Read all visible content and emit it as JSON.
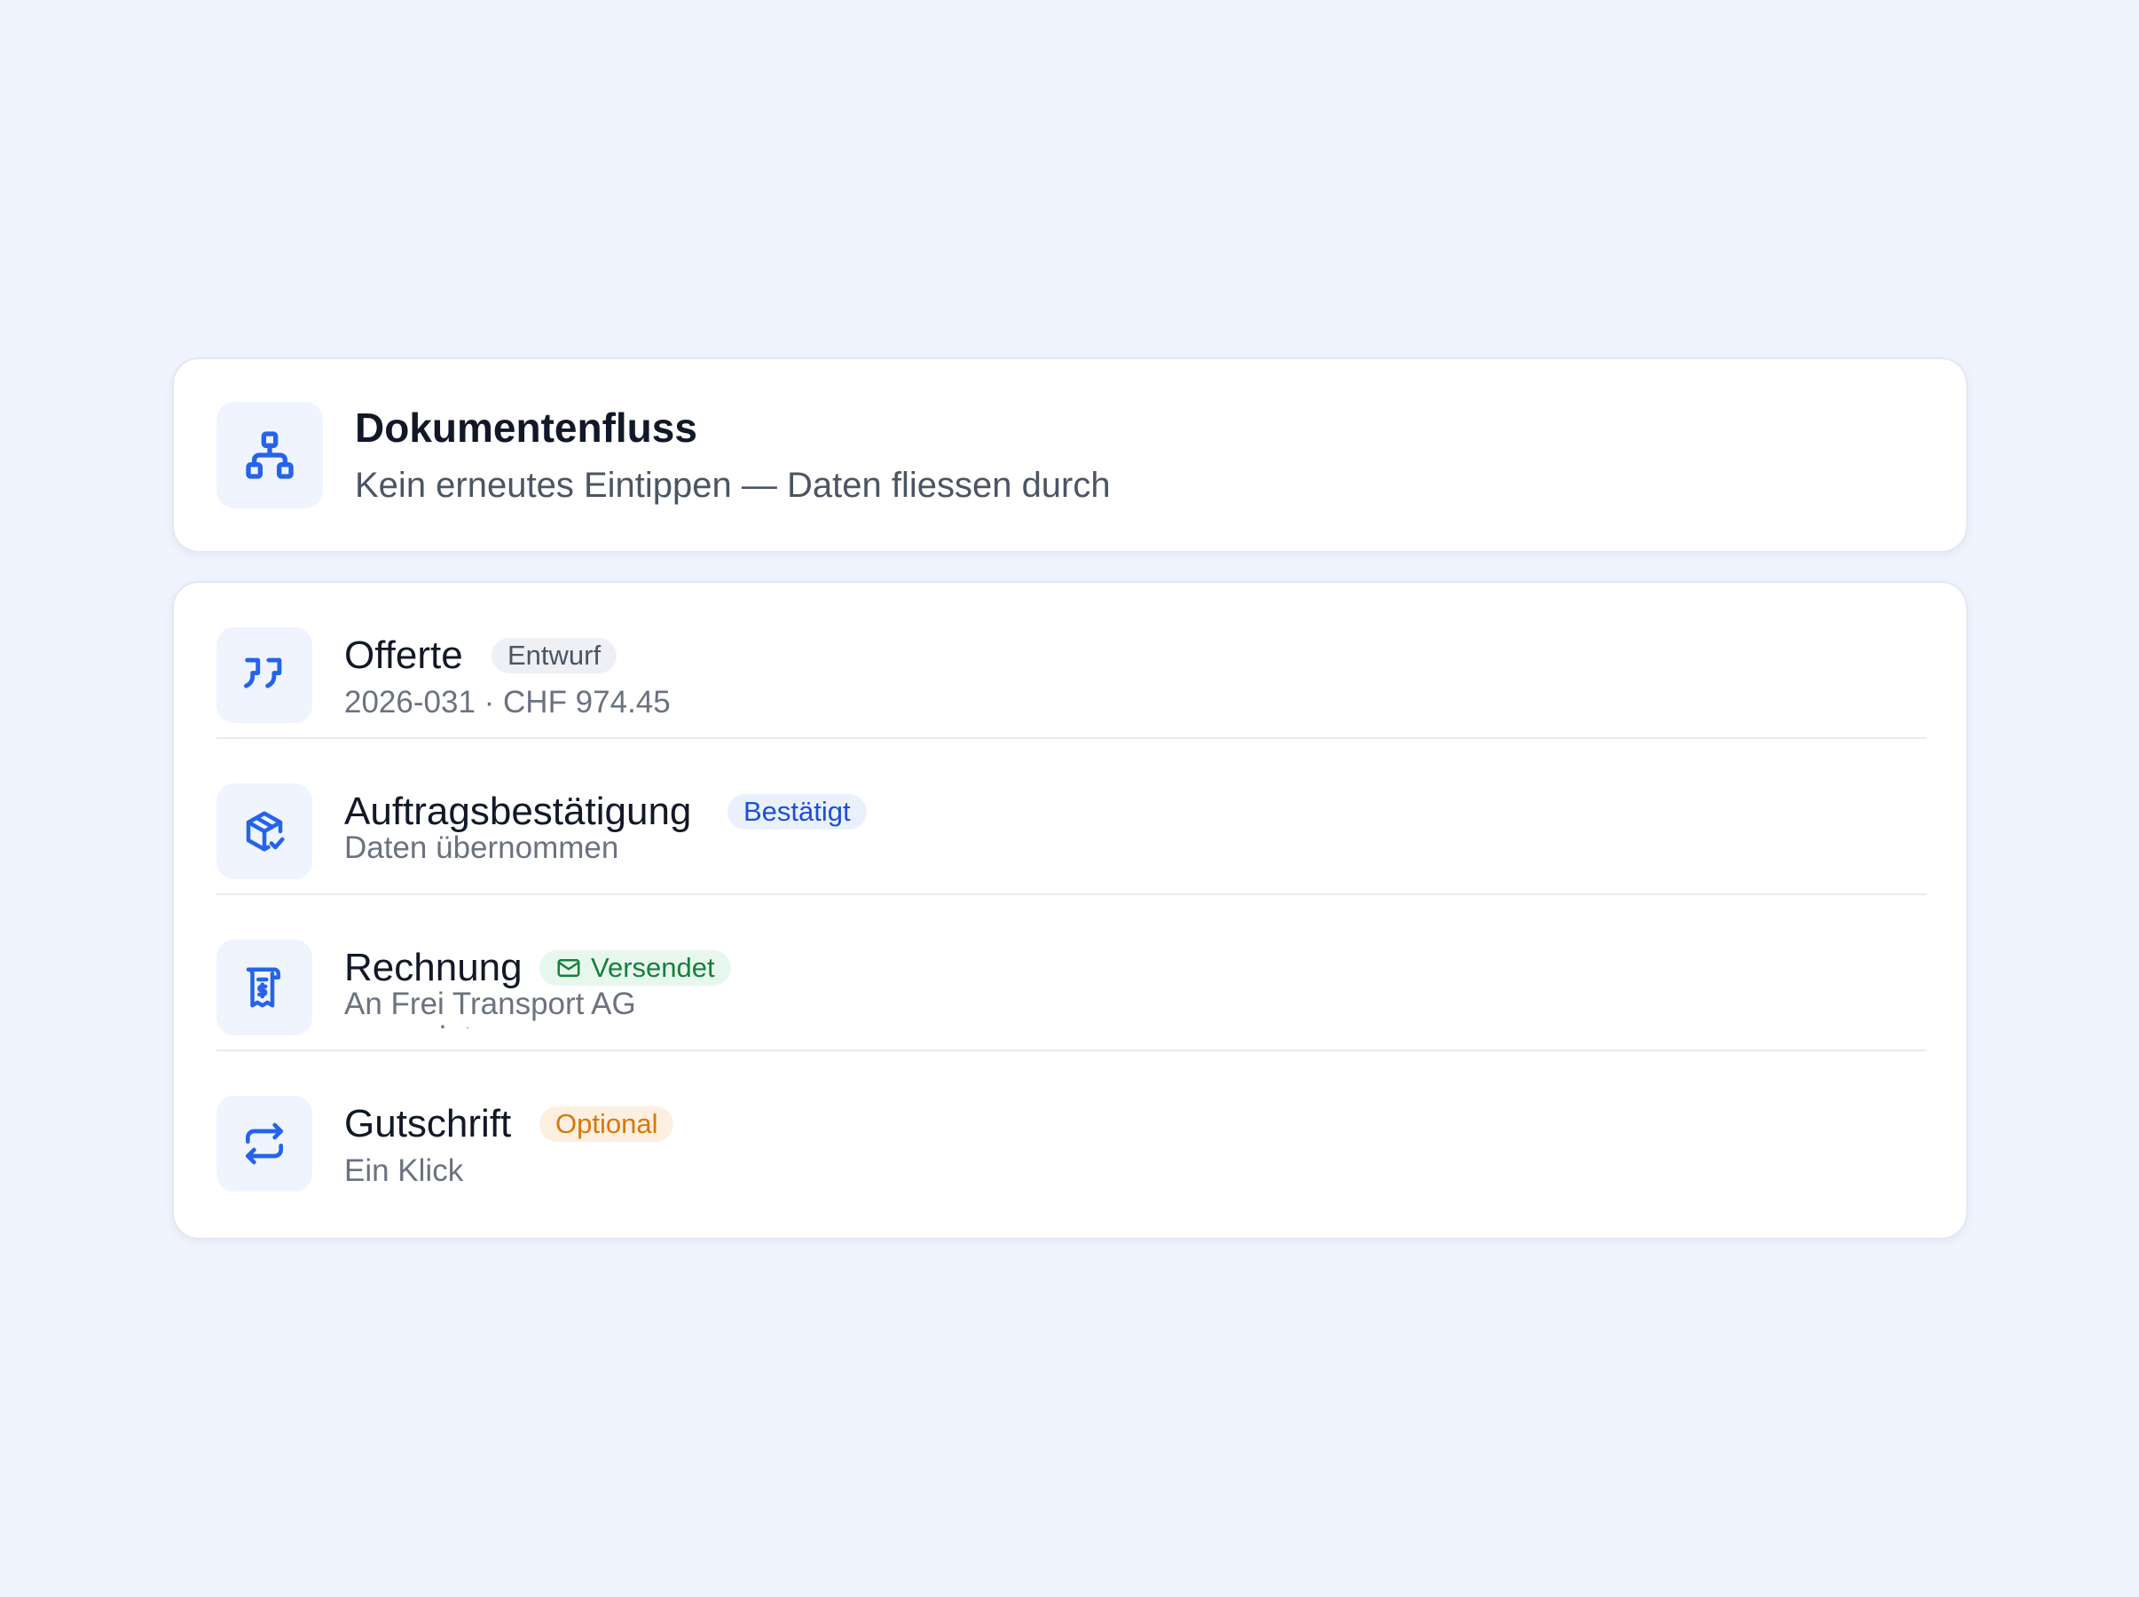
{
  "header": {
    "title": "Dokumentenfluss",
    "subtitle": "Kein erneutes Eintippen — Daten fliessen durch",
    "icon": "sitemap-icon"
  },
  "documents": [
    {
      "title": "Offerte",
      "badge": "Entwurf",
      "badge_color": "#4b5563",
      "subtitle": "2026-031 · CHF 974.45",
      "icon": "quote-icon"
    },
    {
      "title": "Auftragsbestätigung",
      "badge": "Bestätigt",
      "badge_color": "#1d4ed8",
      "subtitle": "Daten übernommen",
      "icon": "package-check-icon"
    },
    {
      "title": "Rechnung",
      "badge": "Versendet",
      "badge_color": "#15803d",
      "badge_icon": "mail-icon",
      "subtitle": "An Frei Transport AG gesendet",
      "icon": "receipt-icon"
    },
    {
      "title": "Gutschrift",
      "badge": "Optional",
      "badge_color": "#d97706",
      "subtitle": "Ein Klick",
      "icon": "repeat-icon"
    }
  ],
  "colors": {
    "background": "#eff4fe",
    "accent": "#2563eb",
    "card": "#ffffff"
  }
}
